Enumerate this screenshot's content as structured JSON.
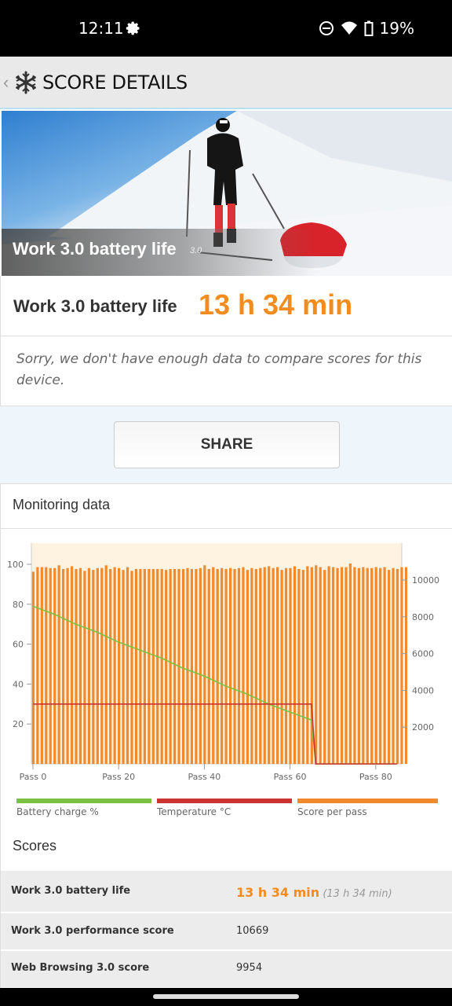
{
  "status_bar": {
    "time": "12:11",
    "battery_percent": "19%",
    "icons": [
      "gear-icon",
      "do-not-disturb-icon",
      "wifi-icon",
      "battery-icon"
    ]
  },
  "app_bar": {
    "back_icon": "chevron-left-icon",
    "logo_icon": "snowflake-icon",
    "title": "SCORE DETAILS"
  },
  "hero": {
    "title": "Work 3.0 battery life",
    "version": "3.0"
  },
  "result": {
    "label": "Work 3.0 battery life",
    "value": "13 h 34 min",
    "accent_color": "#f28c1e"
  },
  "notice": {
    "text": "Sorry, we don't have enough data to compare scores for this device."
  },
  "share": {
    "label": "SHARE"
  },
  "monitoring": {
    "title": "Monitoring data",
    "legend": [
      {
        "label": "Battery charge %",
        "color": "#7cc242"
      },
      {
        "label": "Temperature °C",
        "color": "#cc3333"
      },
      {
        "label": "Score per pass",
        "color": "#f08a2c"
      }
    ]
  },
  "chart_data": {
    "type": "bar",
    "title": "Monitoring data",
    "xlabel": "",
    "ylabel_left": "",
    "ylabel_right": "",
    "x_ticks": [
      "Pass 0",
      "Pass 20",
      "Pass 40",
      "Pass 60",
      "Pass 80"
    ],
    "x_tick_values": [
      0,
      20,
      40,
      60,
      80
    ],
    "x_range": [
      0,
      85
    ],
    "y_left_ticks": [
      20,
      40,
      60,
      80,
      100
    ],
    "y_left_range": [
      0,
      105
    ],
    "y_right_ticks": [
      2000,
      4000,
      6000,
      8000,
      10000
    ],
    "y_right_range": [
      0,
      11500
    ],
    "series": [
      {
        "name": "Score per pass",
        "type": "bar",
        "axis": "right",
        "color": "#f08a2c",
        "values": [
          10450,
          10700,
          10700,
          10700,
          10650,
          10650,
          10800,
          10600,
          10650,
          10750,
          10600,
          10650,
          10500,
          10650,
          10550,
          10650,
          10650,
          10800,
          10600,
          10700,
          10650,
          10550,
          10700,
          10500,
          10600,
          10600,
          10600,
          10600,
          10600,
          10600,
          10600,
          10550,
          10600,
          10600,
          10600,
          10600,
          10650,
          10600,
          10600,
          10650,
          10800,
          10600,
          10700,
          10600,
          10650,
          10600,
          10650,
          10600,
          10650,
          10700,
          10550,
          10650,
          10600,
          10650,
          10700,
          10750,
          10650,
          10700,
          10550,
          10650,
          10650,
          10750,
          10600,
          10550,
          10750,
          10700,
          10800,
          10700,
          10550,
          10750,
          10700,
          10650,
          10700,
          10700,
          10900,
          10700,
          10650,
          10700,
          10650,
          10650,
          10700,
          10650,
          10700,
          10550,
          10650,
          10600,
          10700,
          10700
        ]
      },
      {
        "name": "Battery charge %",
        "type": "line",
        "axis": "left",
        "color": "#7cc242",
        "points": [
          [
            0,
            79
          ],
          [
            5,
            75
          ],
          [
            10,
            70
          ],
          [
            15,
            66
          ],
          [
            20,
            61
          ],
          [
            25,
            57
          ],
          [
            30,
            53
          ],
          [
            35,
            48
          ],
          [
            40,
            44
          ],
          [
            45,
            39
          ],
          [
            50,
            35
          ],
          [
            55,
            30
          ],
          [
            60,
            26
          ],
          [
            65,
            22
          ],
          [
            66,
            0
          ],
          [
            85,
            0
          ]
        ]
      },
      {
        "name": "Temperature °C",
        "type": "line",
        "axis": "left",
        "color": "#cc3333",
        "points": [
          [
            0,
            30
          ],
          [
            65,
            30
          ],
          [
            66,
            0
          ],
          [
            85,
            0
          ]
        ]
      }
    ],
    "legend_position": "bottom",
    "grid": false
  },
  "scores": {
    "title": "Scores",
    "rows": [
      {
        "label": "Work 3.0 battery life",
        "value": "13 h 34 min",
        "sub": "(13 h 34 min)"
      },
      {
        "label": "Work 3.0 performance score",
        "value": "10669",
        "sub": ""
      },
      {
        "label": "Web Browsing 3.0 score",
        "value": "9954",
        "sub": ""
      }
    ]
  }
}
